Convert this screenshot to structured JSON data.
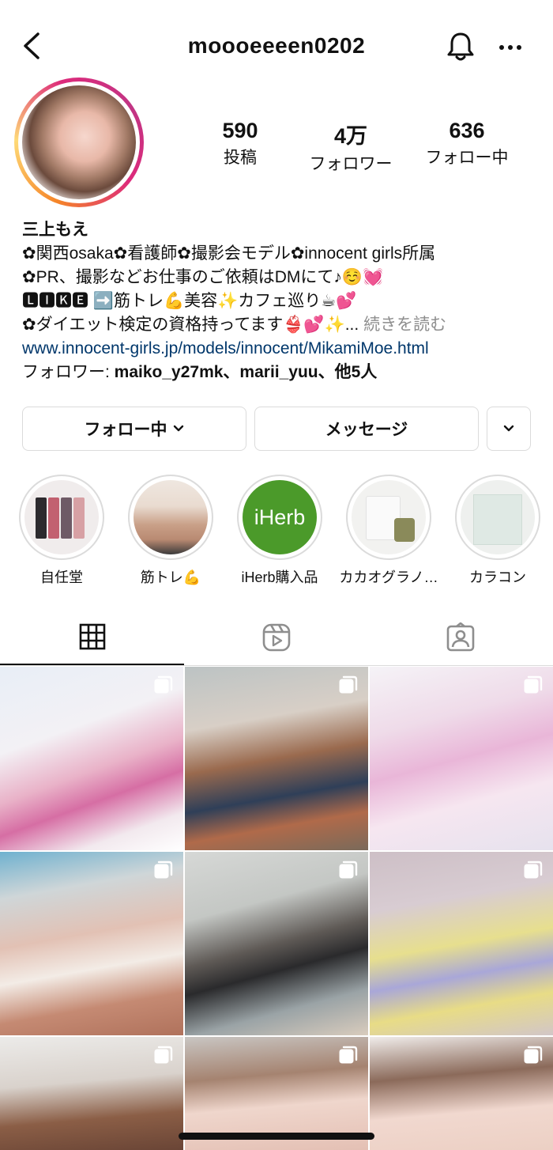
{
  "header": {
    "username": "moooeeeen0202"
  },
  "stats": [
    {
      "value": "590",
      "label": "投稿"
    },
    {
      "value": "4万",
      "label": "フォロワー"
    },
    {
      "value": "636",
      "label": "フォロー中"
    }
  ],
  "bio": {
    "name": "三上もえ",
    "line1": "✿関西osaka✿看護師✿撮影会モデル✿innocent girls所属",
    "line2": "✿PR、撮影などお仕事のご依頼はDMにて♪☺️💓",
    "line3": "🅻🅸🅺🅴 ➡️筋トレ💪美容✨カフェ巡り☕💕",
    "line4": "✿ダイエット検定の資格持ってます👙💕✨...",
    "more_label": "続きを読む",
    "link": "www.innocent-girls.jp/models/innocent/MikamiMoe.html",
    "followed_by_prefix": "フォロワー: ",
    "followed_by_names": "maiko_y27mk、marii_yuu、他5人"
  },
  "buttons": {
    "following": "フォロー中",
    "message": "メッセージ"
  },
  "highlights": [
    {
      "label": "自任堂"
    },
    {
      "label": "筋トレ💪"
    },
    {
      "label": "iHerb購入品",
      "logo_text": "iHerb"
    },
    {
      "label": "カカオグラノ…"
    },
    {
      "label": "カラコン"
    }
  ],
  "colors": {
    "link": "#00376b",
    "iherb": "#4b9a2a",
    "divider": "#dbdbdb"
  }
}
